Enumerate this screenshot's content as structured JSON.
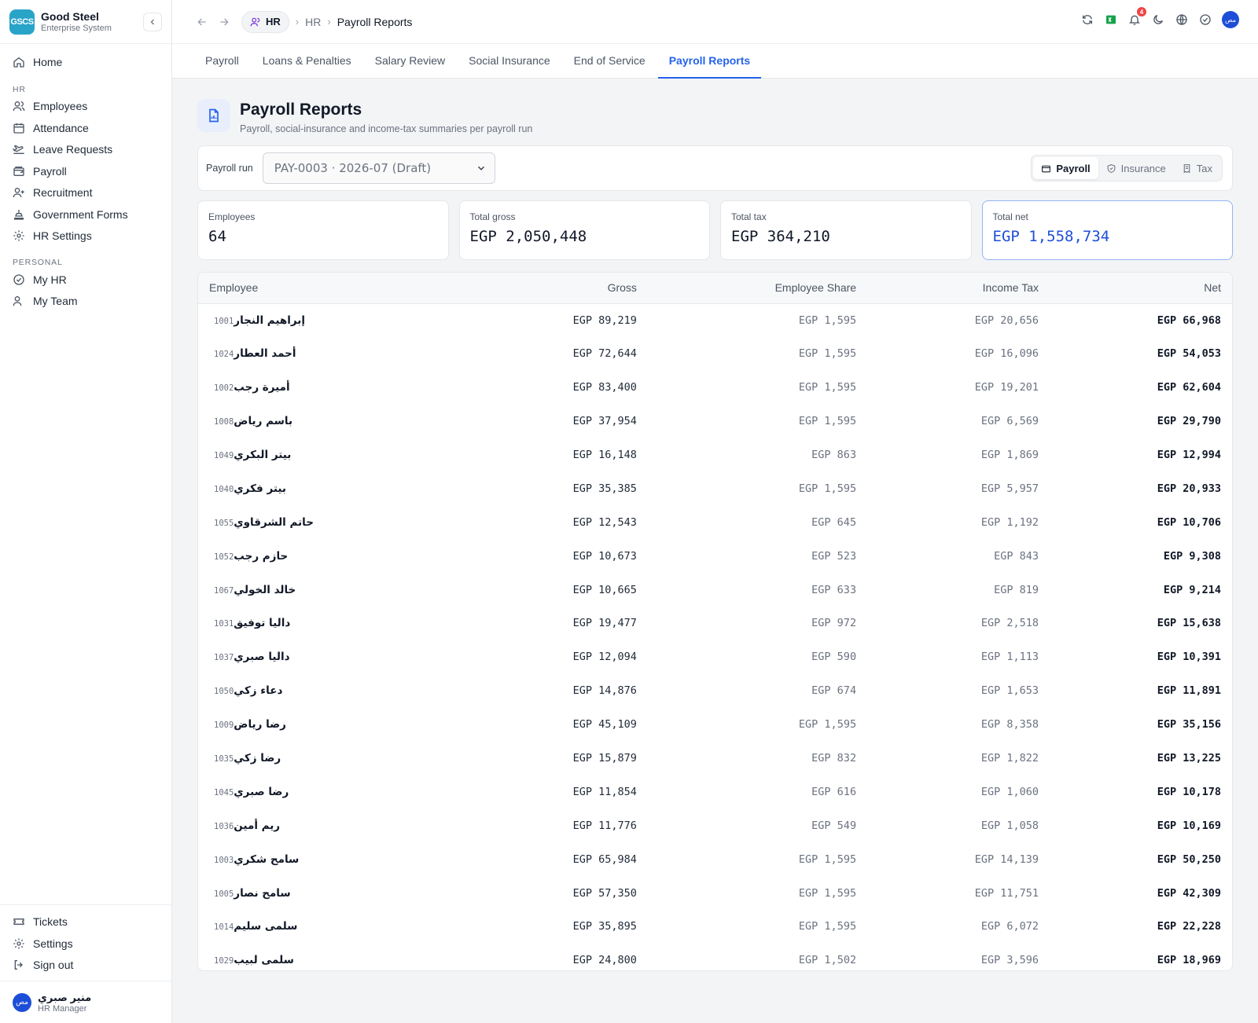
{
  "brand": {
    "logo_text": "GSCS",
    "name": "Good Steel",
    "subtitle": "Enterprise System"
  },
  "sidebar": {
    "home": "Home",
    "hr_label": "HR",
    "hr_items": [
      {
        "label": "Employees",
        "icon": "users-icon"
      },
      {
        "label": "Attendance",
        "icon": "calendar-icon"
      },
      {
        "label": "Leave Requests",
        "icon": "plane-icon"
      },
      {
        "label": "Payroll",
        "icon": "wallet-icon"
      },
      {
        "label": "Recruitment",
        "icon": "user-plus-icon"
      },
      {
        "label": "Government Forms",
        "icon": "landmark-icon"
      },
      {
        "label": "HR Settings",
        "icon": "gear-icon"
      }
    ],
    "personal_label": "PERSONAL",
    "personal_items": [
      {
        "label": "My HR",
        "icon": "check-circle-icon"
      },
      {
        "label": "My Team",
        "icon": "users-icon"
      }
    ],
    "bottom_items": [
      {
        "label": "Tickets",
        "icon": "ticket-icon"
      },
      {
        "label": "Settings",
        "icon": "gear-icon"
      },
      {
        "label": "Sign out",
        "icon": "logout-icon"
      }
    ],
    "user": {
      "avatar": "مص",
      "name": "منير صبري",
      "role": "HR Manager"
    }
  },
  "topbar": {
    "module_pill": "HR",
    "breadcrumb": [
      "HR",
      "Payroll Reports"
    ],
    "notification_count": "4",
    "avatar": "مص"
  },
  "tabs": [
    {
      "label": "Payroll",
      "active": false
    },
    {
      "label": "Loans & Penalties",
      "active": false
    },
    {
      "label": "Salary Review",
      "active": false
    },
    {
      "label": "Social Insurance",
      "active": false
    },
    {
      "label": "End of Service",
      "active": false
    },
    {
      "label": "Payroll Reports",
      "active": true
    }
  ],
  "page": {
    "title": "Payroll Reports",
    "subtitle": "Payroll, social-insurance and income-tax summaries per payroll run"
  },
  "filter": {
    "label": "Payroll run",
    "selected": "PAY-0003 · 2026-07 (Draft)",
    "segments": [
      {
        "label": "Payroll",
        "active": true
      },
      {
        "label": "Insurance",
        "active": false
      },
      {
        "label": "Tax",
        "active": false
      }
    ]
  },
  "stats": [
    {
      "label": "Employees",
      "value": "64"
    },
    {
      "label": "Total gross",
      "value": "EGP 2,050,448"
    },
    {
      "label": "Total tax",
      "value": "EGP 364,210"
    },
    {
      "label": "Total net",
      "value": "EGP 1,558,734"
    }
  ],
  "table": {
    "columns": [
      "Employee",
      "Gross",
      "Employee Share",
      "Income Tax",
      "Net"
    ],
    "rows": [
      {
        "id": "1001",
        "name": "إبراهيم النجار",
        "gross": "EGP 89,219",
        "share": "EGP 1,595",
        "tax": "EGP 20,656",
        "net": "EGP 66,968"
      },
      {
        "id": "1024",
        "name": "أحمد العطار",
        "gross": "EGP 72,644",
        "share": "EGP 1,595",
        "tax": "EGP 16,096",
        "net": "EGP 54,053"
      },
      {
        "id": "1002",
        "name": "أميرة رجب",
        "gross": "EGP 83,400",
        "share": "EGP 1,595",
        "tax": "EGP 19,201",
        "net": "EGP 62,604"
      },
      {
        "id": "1008",
        "name": "باسم رياض",
        "gross": "EGP 37,954",
        "share": "EGP 1,595",
        "tax": "EGP 6,569",
        "net": "EGP 29,790"
      },
      {
        "id": "1049",
        "name": "بيتر البكري",
        "gross": "EGP 16,148",
        "share": "EGP 863",
        "tax": "EGP 1,869",
        "net": "EGP 12,994"
      },
      {
        "id": "1040",
        "name": "بيتر فكري",
        "gross": "EGP 35,385",
        "share": "EGP 1,595",
        "tax": "EGP 5,957",
        "net": "EGP 20,933"
      },
      {
        "id": "1055",
        "name": "حاتم الشرقاوي",
        "gross": "EGP 12,543",
        "share": "EGP 645",
        "tax": "EGP 1,192",
        "net": "EGP 10,706"
      },
      {
        "id": "1052",
        "name": "حازم رجب",
        "gross": "EGP 10,673",
        "share": "EGP 523",
        "tax": "EGP 843",
        "net": "EGP 9,308"
      },
      {
        "id": "1067",
        "name": "خالد الخولي",
        "gross": "EGP 10,665",
        "share": "EGP 633",
        "tax": "EGP 819",
        "net": "EGP 9,214"
      },
      {
        "id": "1031",
        "name": "داليا توفيق",
        "gross": "EGP 19,477",
        "share": "EGP 972",
        "tax": "EGP 2,518",
        "net": "EGP 15,638"
      },
      {
        "id": "1037",
        "name": "داليا صبري",
        "gross": "EGP 12,094",
        "share": "EGP 590",
        "tax": "EGP 1,113",
        "net": "EGP 10,391"
      },
      {
        "id": "1050",
        "name": "دعاء زكي",
        "gross": "EGP 14,876",
        "share": "EGP 674",
        "tax": "EGP 1,653",
        "net": "EGP 11,891"
      },
      {
        "id": "1009",
        "name": "رضا رياض",
        "gross": "EGP 45,109",
        "share": "EGP 1,595",
        "tax": "EGP 8,358",
        "net": "EGP 35,156"
      },
      {
        "id": "1035",
        "name": "رضا زكي",
        "gross": "EGP 15,879",
        "share": "EGP 832",
        "tax": "EGP 1,822",
        "net": "EGP 13,225"
      },
      {
        "id": "1045",
        "name": "رضا صبري",
        "gross": "EGP 11,854",
        "share": "EGP 616",
        "tax": "EGP 1,060",
        "net": "EGP 10,178"
      },
      {
        "id": "1036",
        "name": "ريم أمين",
        "gross": "EGP 11,776",
        "share": "EGP 549",
        "tax": "EGP 1,058",
        "net": "EGP 10,169"
      },
      {
        "id": "1003",
        "name": "سامح شكري",
        "gross": "EGP 65,984",
        "share": "EGP 1,595",
        "tax": "EGP 14,139",
        "net": "EGP 50,250"
      },
      {
        "id": "1005",
        "name": "سامح نصار",
        "gross": "EGP 57,350",
        "share": "EGP 1,595",
        "tax": "EGP 11,751",
        "net": "EGP 42,309"
      },
      {
        "id": "1014",
        "name": "سلمى سليم",
        "gross": "EGP 35,895",
        "share": "EGP 1,595",
        "tax": "EGP 6,072",
        "net": "EGP 22,228"
      },
      {
        "id": "1029",
        "name": "سلمى لبيب",
        "gross": "EGP 24,800",
        "share": "EGP 1,502",
        "tax": "EGP 3,596",
        "net": "EGP 18,969"
      }
    ]
  },
  "colors": {
    "accent": "#2563eb",
    "logo": "#2aa3c9",
    "badge": "#ef4444"
  }
}
